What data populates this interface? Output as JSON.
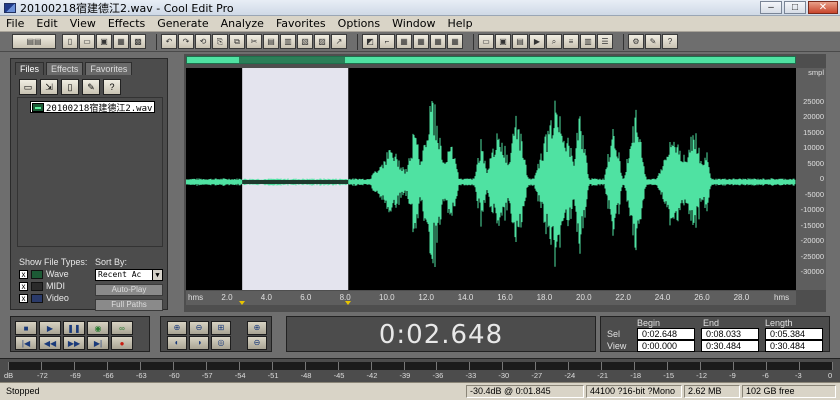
{
  "window": {
    "title": "20100218宿建德江2.wav - Cool Edit Pro",
    "minimize_label": "–",
    "maximize_label": "□",
    "close_label": "✕"
  },
  "menu": [
    "File",
    "Edit",
    "View",
    "Effects",
    "Generate",
    "Analyze",
    "Favorites",
    "Options",
    "Window",
    "Help"
  ],
  "organizer": {
    "tabs": [
      "Files",
      "Effects",
      "Favorites"
    ],
    "active_tab": "Files",
    "files": [
      {
        "name": "20100218宿建德江2.wav",
        "icon": "wave-file-icon"
      }
    ],
    "show_file_types_label": "Show File Types:",
    "file_types": [
      {
        "label": "Wave",
        "checked": true,
        "mark": "x"
      },
      {
        "label": "MIDI",
        "checked": true,
        "mark": "x"
      },
      {
        "label": "Video",
        "checked": true,
        "mark": "x"
      }
    ],
    "sort_by_label": "Sort By:",
    "sort_by_value": "Recent Ac",
    "auto_play_label": "Auto-Play",
    "full_paths_label": "Full Paths"
  },
  "waveform": {
    "wave_color": "#4fe2a2",
    "selection_color": "#e4e4ee",
    "amplitude_unit": "smpl",
    "amplitude_labels": [
      "25000",
      "20000",
      "15000",
      "10000",
      "5000",
      "0",
      "-5000",
      "-10000",
      "-15000",
      "-20000",
      "-25000",
      "-30000"
    ],
    "time_unit_left": "hms",
    "time_unit_right": "hms",
    "time_labels": [
      "2.0",
      "4.0",
      "6.0",
      "8.0",
      "10.0",
      "12.0",
      "14.0",
      "16.0",
      "18.0",
      "20.0",
      "22.0",
      "24.0",
      "26.0",
      "28.0",
      "30.0"
    ],
    "selection": {
      "begin": 2.648,
      "end": 8.033
    }
  },
  "transport": {
    "row1": [
      {
        "name": "stop-icon",
        "glyph": "■"
      },
      {
        "name": "play-icon",
        "glyph": "▶"
      },
      {
        "name": "pause-icon",
        "glyph": "❚❚"
      },
      {
        "name": "play-to-end-icon",
        "glyph": "◉"
      },
      {
        "name": "loop-icon",
        "glyph": "∞"
      }
    ],
    "row2": [
      {
        "name": "go-to-start-icon",
        "glyph": "|◀"
      },
      {
        "name": "rewind-icon",
        "glyph": "◀◀"
      },
      {
        "name": "fast-forward-icon",
        "glyph": "▶▶"
      },
      {
        "name": "go-to-end-icon",
        "glyph": "▶|"
      },
      {
        "name": "record-icon",
        "glyph": "●"
      }
    ]
  },
  "current_time": "0:02.648",
  "selection_panel": {
    "begin_label": "Begin",
    "end_label": "End",
    "length_label": "Length",
    "sel_label": "Sel",
    "view_label": "View",
    "sel_begin": "0:02.648",
    "sel_end": "0:08.033",
    "sel_length": "0:05.384",
    "view_begin": "0:00.000",
    "view_end": "0:30.484",
    "view_length": "0:30.484"
  },
  "meter": {
    "labels": [
      "dB",
      "-72",
      "-69",
      "-66",
      "-63",
      "-60",
      "-57",
      "-54",
      "-51",
      "-48",
      "-45",
      "-42",
      "-39",
      "-36",
      "-33",
      "-30",
      "-27",
      "-24",
      "-21",
      "-18",
      "-15",
      "-12",
      "-9",
      "-6",
      "-3",
      "0"
    ]
  },
  "status": {
    "state": "Stopped",
    "cursor_level": "-30.4dB @  0:01.845",
    "format": "44100 ?16-bit ?Mono",
    "size": "2.62 MB",
    "free_space": "102 GB free"
  }
}
